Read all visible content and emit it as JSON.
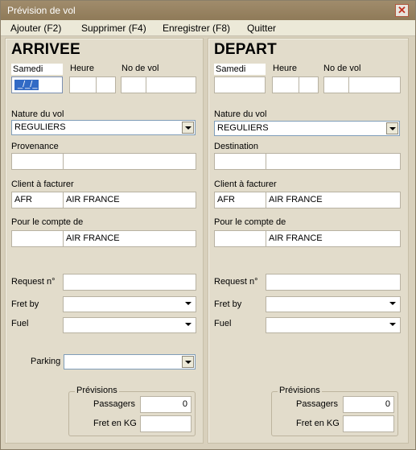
{
  "window": {
    "title": "Prévision de vol",
    "close_glyph": "✕"
  },
  "menu": [
    "Ajouter (F2)",
    "Supprimer (F4)",
    "Enregistrer (F8)",
    "Quitter"
  ],
  "arrivee": {
    "heading": "ARRIVEE",
    "day_label": "Samedi",
    "heure_label": "Heure",
    "novol_label": "No de vol",
    "date_value": "_/_/_",
    "nature_label": "Nature du vol",
    "nature_value": "REGULIERS",
    "place_label": "Provenance",
    "client_label": "Client à facturer",
    "client_code": "AFR",
    "client_name": "AIR FRANCE",
    "compte_label": "Pour le compte de",
    "compte_code": "",
    "compte_name": "AIR FRANCE",
    "request_label": "Request n°",
    "fretby_label": "Fret by",
    "fuel_label": "Fuel",
    "parking_label": "Parking",
    "previsions_label": "Prévisions",
    "passagers_label": "Passagers",
    "passagers_value": "0",
    "fret_label": "Fret en KG",
    "fret_value": ""
  },
  "depart": {
    "heading": "DEPART",
    "day_label": "Samedi",
    "heure_label": "Heure",
    "novol_label": "No de vol",
    "nature_label": "Nature du vol",
    "nature_value": "REGULIERS",
    "place_label": "Destination",
    "client_label": "Client à facturer",
    "client_code": "AFR",
    "client_name": "AIR FRANCE",
    "compte_label": "Pour le compte de",
    "compte_code": "",
    "compte_name": "AIR FRANCE",
    "request_label": "Request n°",
    "fretby_label": "Fret by",
    "fuel_label": "Fuel",
    "previsions_label": "Prévisions",
    "passagers_label": "Passagers",
    "passagers_value": "0",
    "fret_label": "Fret en KG",
    "fret_value": ""
  }
}
